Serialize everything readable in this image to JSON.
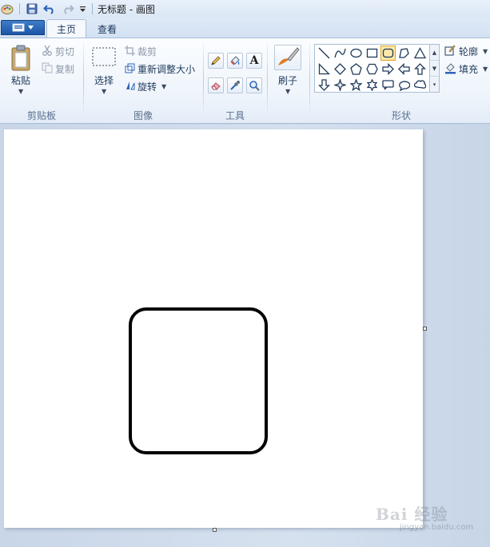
{
  "window": {
    "title": "无标题 - 画图"
  },
  "quick_access": {
    "icons": [
      "paint-app-icon",
      "save-icon",
      "undo-icon",
      "redo-icon",
      "customize-toolbar-icon"
    ]
  },
  "tabs": [
    {
      "label": "主页",
      "active": true
    },
    {
      "label": "查看",
      "active": false
    }
  ],
  "ribbon": {
    "clipboard": {
      "group_label": "剪贴板",
      "paste_label": "粘贴",
      "cut_label": "剪切",
      "copy_label": "复制"
    },
    "image": {
      "group_label": "图像",
      "select_label": "选择",
      "crop_label": "裁剪",
      "resize_label": "重新调整大小",
      "rotate_label": "旋转"
    },
    "tools": {
      "group_label": "工具",
      "items": [
        "pencil-icon",
        "fill-bucket-icon",
        "text-icon",
        "eraser-icon",
        "color-picker-icon",
        "magnifier-icon"
      ],
      "text_glyph": "A"
    },
    "brushes": {
      "label": "刷子"
    },
    "shapes": {
      "group_label": "形状",
      "selected": "rounded-rectangle",
      "outline_label": "轮廓",
      "fill_label": "填充"
    }
  },
  "watermark": {
    "text": "Bai 经验",
    "subtext": "jingyan.baidu.com"
  }
}
